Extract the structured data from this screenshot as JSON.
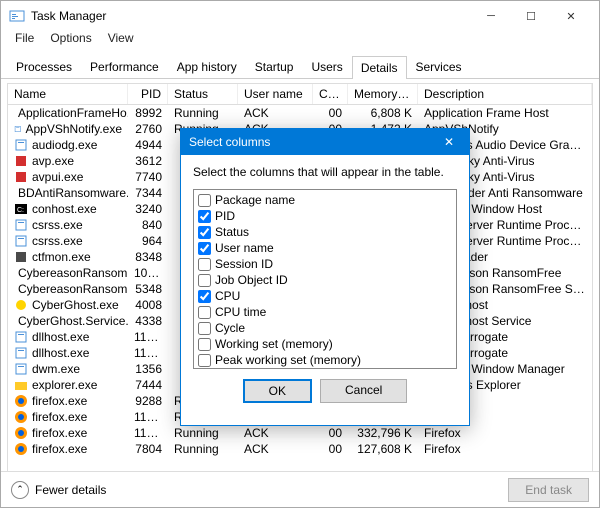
{
  "window": {
    "title": "Task Manager"
  },
  "menu": [
    "File",
    "Options",
    "View"
  ],
  "tabs": [
    "Processes",
    "Performance",
    "App history",
    "Startup",
    "Users",
    "Details",
    "Services"
  ],
  "active_tab": 5,
  "columns": [
    "Name",
    "PID",
    "Status",
    "User name",
    "CPU",
    "Memory (p...",
    "Description"
  ],
  "rows": [
    {
      "icon": "generic",
      "name": "ApplicationFrameHo...",
      "pid": "8992",
      "status": "Running",
      "user": "ACK",
      "cpu": "00",
      "mem": "6,808 K",
      "desc": "Application Frame Host"
    },
    {
      "icon": "generic",
      "name": "AppVShNotify.exe",
      "pid": "2760",
      "status": "Running",
      "user": "ACK",
      "cpu": "00",
      "mem": "1,472 K",
      "desc": "AppVShNotify"
    },
    {
      "icon": "generic",
      "name": "audiodg.exe",
      "pid": "4944",
      "status": "R",
      "user": "",
      "cpu": "",
      "mem": "",
      "desc": "Windows Audio Device Graph Isol"
    },
    {
      "icon": "red",
      "name": "avp.exe",
      "pid": "3612",
      "status": "R",
      "user": "",
      "cpu": "",
      "mem": "",
      "desc": "Kaspersky Anti-Virus"
    },
    {
      "icon": "red",
      "name": "avpui.exe",
      "pid": "7740",
      "status": "R",
      "user": "",
      "cpu": "",
      "mem": "",
      "desc": "Kaspersky Anti-Virus"
    },
    {
      "icon": "bd",
      "name": "BDAntiRansomware...",
      "pid": "7344",
      "status": "R",
      "user": "",
      "cpu": "",
      "mem": "",
      "desc": "Bitdefender Anti Ransomware"
    },
    {
      "icon": "con",
      "name": "conhost.exe",
      "pid": "3240",
      "status": "R",
      "user": "",
      "cpu": "",
      "mem": "",
      "desc": "Console Window Host"
    },
    {
      "icon": "generic",
      "name": "csrss.exe",
      "pid": "840",
      "status": "R",
      "user": "",
      "cpu": "",
      "mem": "",
      "desc": "Client Server Runtime Process"
    },
    {
      "icon": "generic",
      "name": "csrss.exe",
      "pid": "964",
      "status": "R",
      "user": "",
      "cpu": "",
      "mem": "",
      "desc": "Client Server Runtime Process"
    },
    {
      "icon": "ctf",
      "name": "ctfmon.exe",
      "pid": "8348",
      "status": "R",
      "user": "",
      "cpu": "",
      "mem": "",
      "desc": "CTF Loader"
    },
    {
      "icon": "generic",
      "name": "CybereasonRansom...",
      "pid": "10028",
      "status": "R",
      "user": "",
      "cpu": "",
      "mem": "",
      "desc": "Cybereason RansomFree"
    },
    {
      "icon": "generic",
      "name": "CybereasonRansom...",
      "pid": "5348",
      "status": "R",
      "user": "",
      "cpu": "",
      "mem": "",
      "desc": "Cybereason RansomFree Service"
    },
    {
      "icon": "ghost",
      "name": "CyberGhost.exe",
      "pid": "4008",
      "status": "R",
      "user": "",
      "cpu": "",
      "mem": "",
      "desc": "CyberGhost"
    },
    {
      "icon": "gear",
      "name": "CyberGhost.Service....",
      "pid": "4338",
      "status": "R",
      "user": "",
      "cpu": "",
      "mem": "",
      "desc": "CyberGhost Service"
    },
    {
      "icon": "generic",
      "name": "dllhost.exe",
      "pid": "11496",
      "status": "R",
      "user": "",
      "cpu": "",
      "mem": "",
      "desc": "COM Surrogate"
    },
    {
      "icon": "generic",
      "name": "dllhost.exe",
      "pid": "11476",
      "status": "R",
      "user": "",
      "cpu": "",
      "mem": "",
      "desc": "COM Surrogate"
    },
    {
      "icon": "generic",
      "name": "dwm.exe",
      "pid": "1356",
      "status": "R",
      "user": "",
      "cpu": "",
      "mem": "",
      "desc": "Desktop Window Manager"
    },
    {
      "icon": "folder",
      "name": "explorer.exe",
      "pid": "7444",
      "status": "R",
      "user": "",
      "cpu": "",
      "mem": "",
      "desc": "Windows Explorer"
    },
    {
      "icon": "firefox",
      "name": "firefox.exe",
      "pid": "9288",
      "status": "Running",
      "user": "ACK",
      "cpu": "01",
      "mem": "200,103 K",
      "desc": "Firefox"
    },
    {
      "icon": "firefox",
      "name": "firefox.exe",
      "pid": "11692",
      "status": "Running",
      "user": "ACK",
      "cpu": "00",
      "mem": "37,152 K",
      "desc": "Firefox"
    },
    {
      "icon": "firefox",
      "name": "firefox.exe",
      "pid": "11680",
      "status": "Running",
      "user": "ACK",
      "cpu": "00",
      "mem": "332,796 K",
      "desc": "Firefox"
    },
    {
      "icon": "firefox",
      "name": "firefox.exe",
      "pid": "7804",
      "status": "Running",
      "user": "ACK",
      "cpu": "00",
      "mem": "127,608 K",
      "desc": "Firefox"
    }
  ],
  "footer": {
    "fewer": "Fewer details",
    "end_task": "End task"
  },
  "modal": {
    "title": "Select columns",
    "message": "Select the columns that will appear in the table.",
    "items": [
      {
        "label": "Package name",
        "checked": false
      },
      {
        "label": "PID",
        "checked": true
      },
      {
        "label": "Status",
        "checked": true
      },
      {
        "label": "User name",
        "checked": true
      },
      {
        "label": "Session ID",
        "checked": false
      },
      {
        "label": "Job Object ID",
        "checked": false
      },
      {
        "label": "CPU",
        "checked": true
      },
      {
        "label": "CPU time",
        "checked": false
      },
      {
        "label": "Cycle",
        "checked": false
      },
      {
        "label": "Working set (memory)",
        "checked": false
      },
      {
        "label": "Peak working set (memory)",
        "checked": false
      }
    ],
    "ok": "OK",
    "cancel": "Cancel"
  }
}
